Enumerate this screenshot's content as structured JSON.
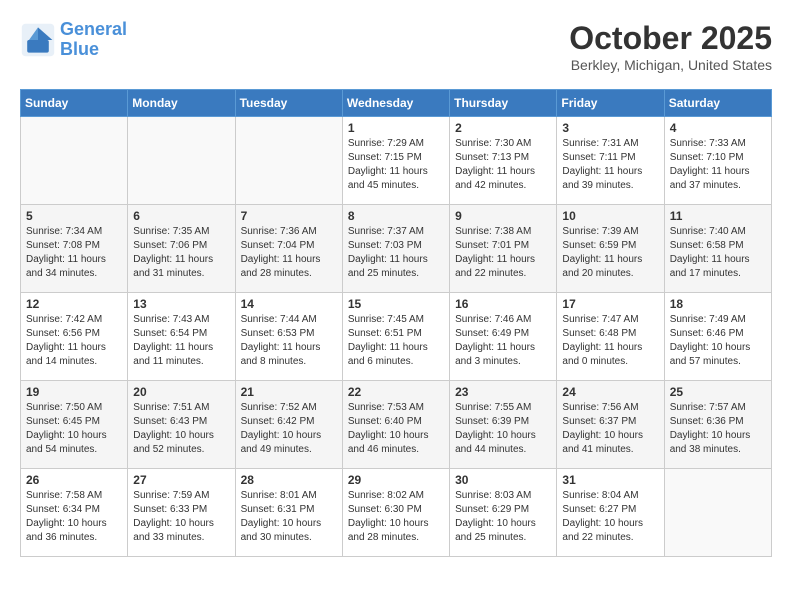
{
  "logo": {
    "line1": "General",
    "line2": "Blue"
  },
  "title": "October 2025",
  "location": "Berkley, Michigan, United States",
  "weekdays": [
    "Sunday",
    "Monday",
    "Tuesday",
    "Wednesday",
    "Thursday",
    "Friday",
    "Saturday"
  ],
  "weeks": [
    [
      {
        "day": "",
        "sunrise": "",
        "sunset": "",
        "daylight": ""
      },
      {
        "day": "",
        "sunrise": "",
        "sunset": "",
        "daylight": ""
      },
      {
        "day": "",
        "sunrise": "",
        "sunset": "",
        "daylight": ""
      },
      {
        "day": "1",
        "sunrise": "Sunrise: 7:29 AM",
        "sunset": "Sunset: 7:15 PM",
        "daylight": "Daylight: 11 hours and 45 minutes."
      },
      {
        "day": "2",
        "sunrise": "Sunrise: 7:30 AM",
        "sunset": "Sunset: 7:13 PM",
        "daylight": "Daylight: 11 hours and 42 minutes."
      },
      {
        "day": "3",
        "sunrise": "Sunrise: 7:31 AM",
        "sunset": "Sunset: 7:11 PM",
        "daylight": "Daylight: 11 hours and 39 minutes."
      },
      {
        "day": "4",
        "sunrise": "Sunrise: 7:33 AM",
        "sunset": "Sunset: 7:10 PM",
        "daylight": "Daylight: 11 hours and 37 minutes."
      }
    ],
    [
      {
        "day": "5",
        "sunrise": "Sunrise: 7:34 AM",
        "sunset": "Sunset: 7:08 PM",
        "daylight": "Daylight: 11 hours and 34 minutes."
      },
      {
        "day": "6",
        "sunrise": "Sunrise: 7:35 AM",
        "sunset": "Sunset: 7:06 PM",
        "daylight": "Daylight: 11 hours and 31 minutes."
      },
      {
        "day": "7",
        "sunrise": "Sunrise: 7:36 AM",
        "sunset": "Sunset: 7:04 PM",
        "daylight": "Daylight: 11 hours and 28 minutes."
      },
      {
        "day": "8",
        "sunrise": "Sunrise: 7:37 AM",
        "sunset": "Sunset: 7:03 PM",
        "daylight": "Daylight: 11 hours and 25 minutes."
      },
      {
        "day": "9",
        "sunrise": "Sunrise: 7:38 AM",
        "sunset": "Sunset: 7:01 PM",
        "daylight": "Daylight: 11 hours and 22 minutes."
      },
      {
        "day": "10",
        "sunrise": "Sunrise: 7:39 AM",
        "sunset": "Sunset: 6:59 PM",
        "daylight": "Daylight: 11 hours and 20 minutes."
      },
      {
        "day": "11",
        "sunrise": "Sunrise: 7:40 AM",
        "sunset": "Sunset: 6:58 PM",
        "daylight": "Daylight: 11 hours and 17 minutes."
      }
    ],
    [
      {
        "day": "12",
        "sunrise": "Sunrise: 7:42 AM",
        "sunset": "Sunset: 6:56 PM",
        "daylight": "Daylight: 11 hours and 14 minutes."
      },
      {
        "day": "13",
        "sunrise": "Sunrise: 7:43 AM",
        "sunset": "Sunset: 6:54 PM",
        "daylight": "Daylight: 11 hours and 11 minutes."
      },
      {
        "day": "14",
        "sunrise": "Sunrise: 7:44 AM",
        "sunset": "Sunset: 6:53 PM",
        "daylight": "Daylight: 11 hours and 8 minutes."
      },
      {
        "day": "15",
        "sunrise": "Sunrise: 7:45 AM",
        "sunset": "Sunset: 6:51 PM",
        "daylight": "Daylight: 11 hours and 6 minutes."
      },
      {
        "day": "16",
        "sunrise": "Sunrise: 7:46 AM",
        "sunset": "Sunset: 6:49 PM",
        "daylight": "Daylight: 11 hours and 3 minutes."
      },
      {
        "day": "17",
        "sunrise": "Sunrise: 7:47 AM",
        "sunset": "Sunset: 6:48 PM",
        "daylight": "Daylight: 11 hours and 0 minutes."
      },
      {
        "day": "18",
        "sunrise": "Sunrise: 7:49 AM",
        "sunset": "Sunset: 6:46 PM",
        "daylight": "Daylight: 10 hours and 57 minutes."
      }
    ],
    [
      {
        "day": "19",
        "sunrise": "Sunrise: 7:50 AM",
        "sunset": "Sunset: 6:45 PM",
        "daylight": "Daylight: 10 hours and 54 minutes."
      },
      {
        "day": "20",
        "sunrise": "Sunrise: 7:51 AM",
        "sunset": "Sunset: 6:43 PM",
        "daylight": "Daylight: 10 hours and 52 minutes."
      },
      {
        "day": "21",
        "sunrise": "Sunrise: 7:52 AM",
        "sunset": "Sunset: 6:42 PM",
        "daylight": "Daylight: 10 hours and 49 minutes."
      },
      {
        "day": "22",
        "sunrise": "Sunrise: 7:53 AM",
        "sunset": "Sunset: 6:40 PM",
        "daylight": "Daylight: 10 hours and 46 minutes."
      },
      {
        "day": "23",
        "sunrise": "Sunrise: 7:55 AM",
        "sunset": "Sunset: 6:39 PM",
        "daylight": "Daylight: 10 hours and 44 minutes."
      },
      {
        "day": "24",
        "sunrise": "Sunrise: 7:56 AM",
        "sunset": "Sunset: 6:37 PM",
        "daylight": "Daylight: 10 hours and 41 minutes."
      },
      {
        "day": "25",
        "sunrise": "Sunrise: 7:57 AM",
        "sunset": "Sunset: 6:36 PM",
        "daylight": "Daylight: 10 hours and 38 minutes."
      }
    ],
    [
      {
        "day": "26",
        "sunrise": "Sunrise: 7:58 AM",
        "sunset": "Sunset: 6:34 PM",
        "daylight": "Daylight: 10 hours and 36 minutes."
      },
      {
        "day": "27",
        "sunrise": "Sunrise: 7:59 AM",
        "sunset": "Sunset: 6:33 PM",
        "daylight": "Daylight: 10 hours and 33 minutes."
      },
      {
        "day": "28",
        "sunrise": "Sunrise: 8:01 AM",
        "sunset": "Sunset: 6:31 PM",
        "daylight": "Daylight: 10 hours and 30 minutes."
      },
      {
        "day": "29",
        "sunrise": "Sunrise: 8:02 AM",
        "sunset": "Sunset: 6:30 PM",
        "daylight": "Daylight: 10 hours and 28 minutes."
      },
      {
        "day": "30",
        "sunrise": "Sunrise: 8:03 AM",
        "sunset": "Sunset: 6:29 PM",
        "daylight": "Daylight: 10 hours and 25 minutes."
      },
      {
        "day": "31",
        "sunrise": "Sunrise: 8:04 AM",
        "sunset": "Sunset: 6:27 PM",
        "daylight": "Daylight: 10 hours and 22 minutes."
      },
      {
        "day": "",
        "sunrise": "",
        "sunset": "",
        "daylight": ""
      }
    ]
  ]
}
